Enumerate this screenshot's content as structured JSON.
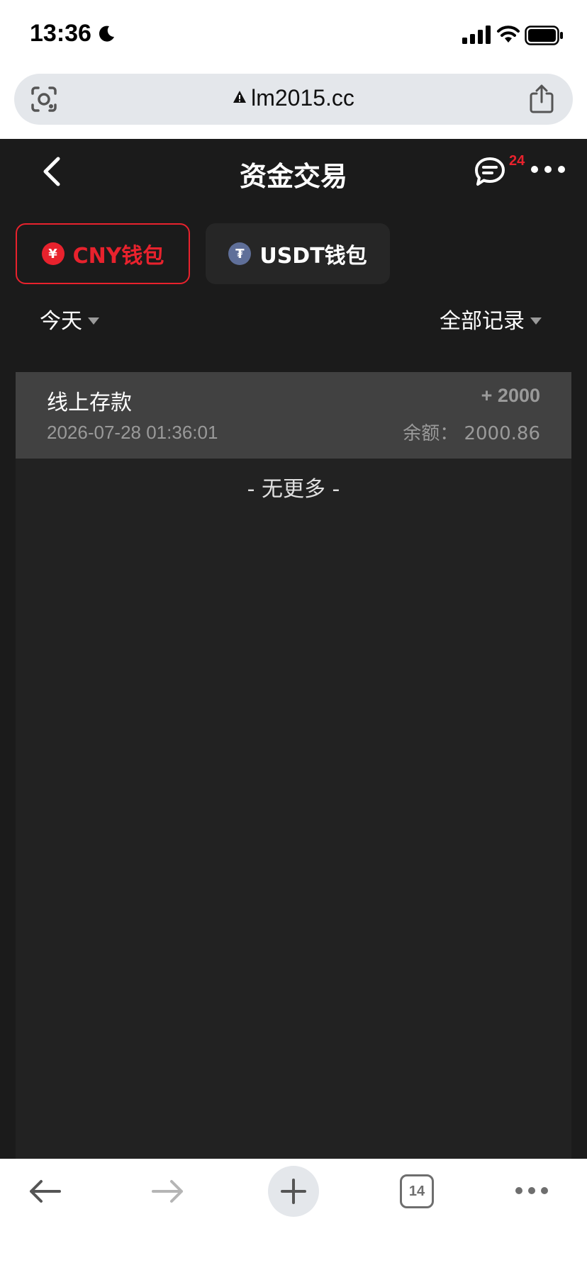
{
  "status_bar": {
    "time": "13:36"
  },
  "browser": {
    "url": "lm2015.cc",
    "tab_count": "14"
  },
  "header": {
    "title": "资金交易",
    "chat_badge": "24"
  },
  "wallet_tabs": [
    {
      "label": "CNY钱包",
      "icon_glyph": "¥",
      "active": true
    },
    {
      "label": "USDT钱包",
      "icon_glyph": "₮",
      "active": false
    }
  ],
  "filters": {
    "date": "今天",
    "record_type": "全部记录"
  },
  "transactions": [
    {
      "title": "线上存款",
      "time": "2026-07-28 01:36:01",
      "amount": "+ 2000",
      "balance": "余额：  2000.86"
    }
  ],
  "list_end_text": "- 无更多 -",
  "colors": {
    "accent_red": "#e8222d",
    "background": "#1b1b1b",
    "row_bg": "#414141"
  }
}
